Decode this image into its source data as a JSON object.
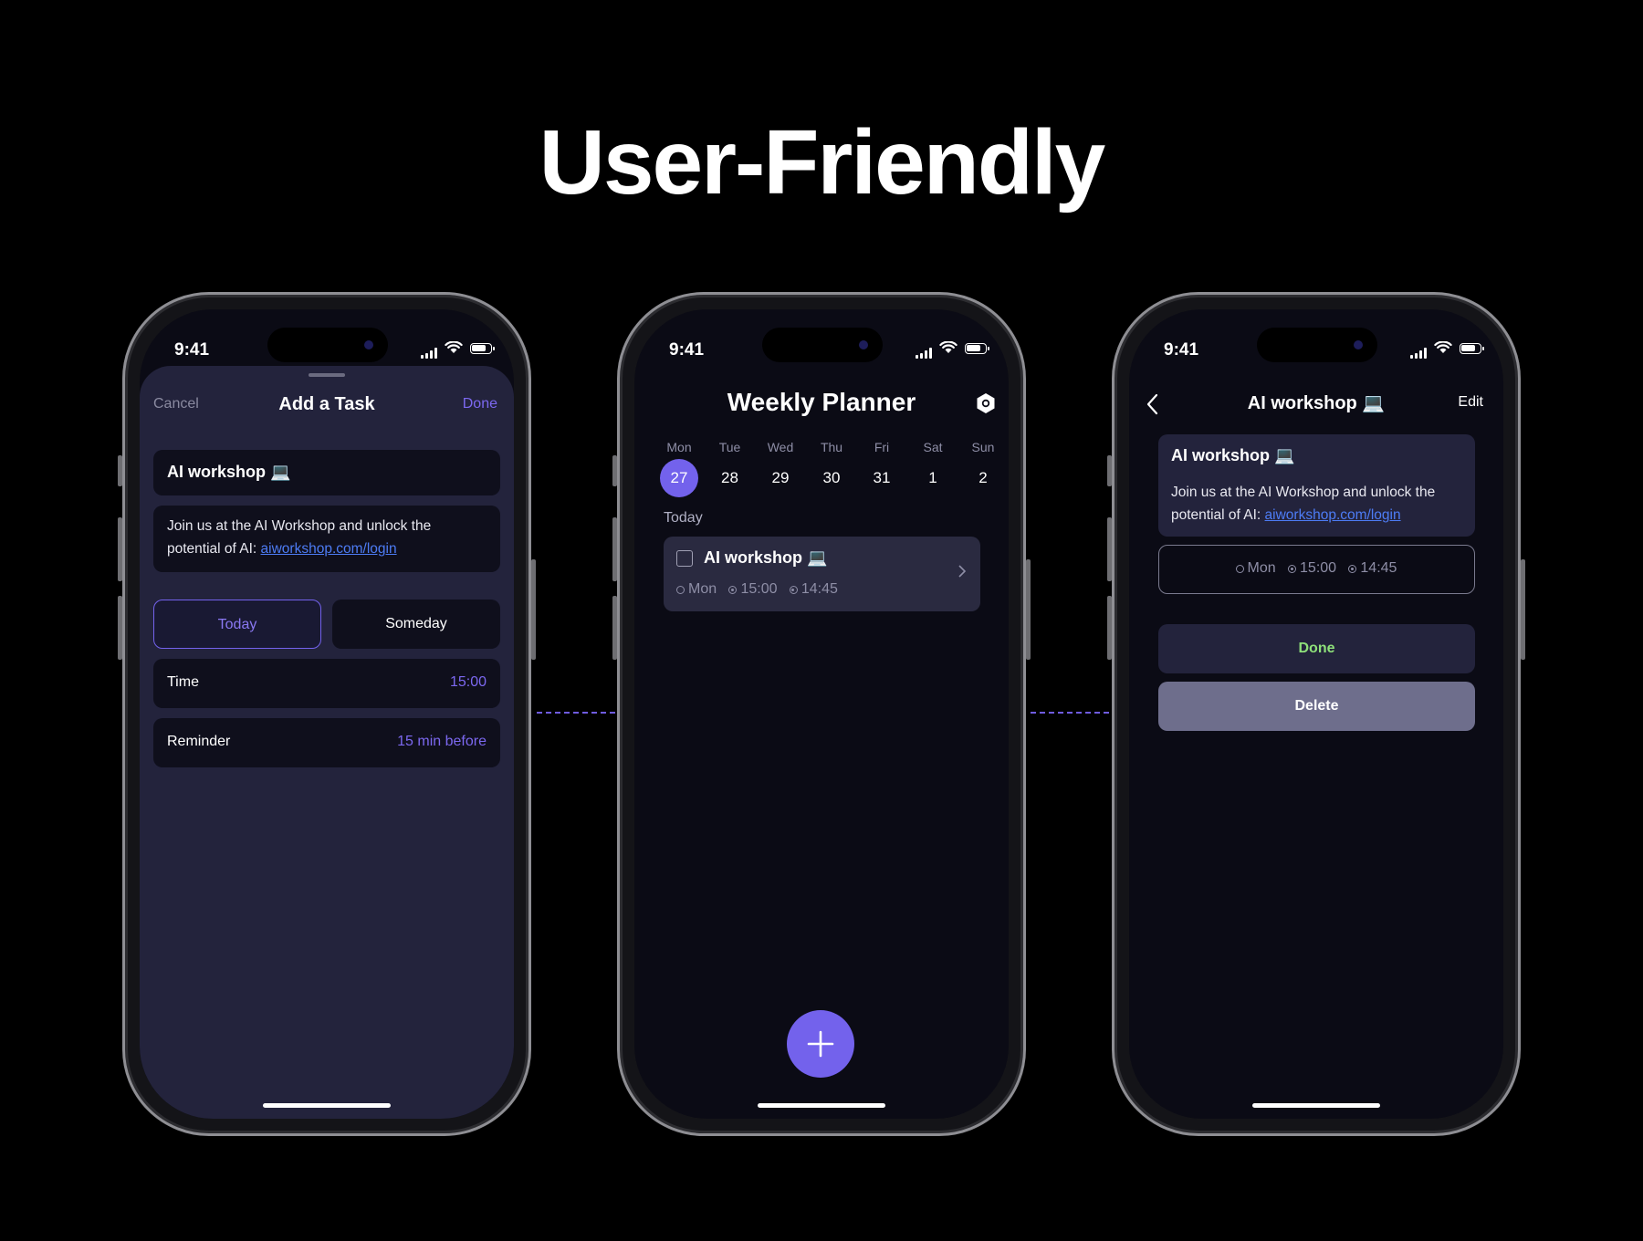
{
  "headline": "User-Friendly",
  "colors": {
    "accent": "#7362ec",
    "link": "#4d7cf5",
    "done_green": "#8ee07a",
    "sheet_bg": "#23233c"
  },
  "status": {
    "time": "9:41"
  },
  "add_task": {
    "cancel_label": "Cancel",
    "title": "Add  a Task",
    "done_label": "Done",
    "task_title": "AI workshop 💻",
    "description_text": "Join us at the AI Workshop and unlock the potential of AI: ",
    "description_link": "aiworkshop.com/login",
    "segment_today": "Today",
    "segment_someday": "Someday",
    "time_label": "Time",
    "time_value": "15:00",
    "reminder_label": "Reminder",
    "reminder_value": "15 min before"
  },
  "planner": {
    "title": "Weekly Planner",
    "days": [
      {
        "dow": "Mon",
        "num": "27",
        "selected": true
      },
      {
        "dow": "Tue",
        "num": "28"
      },
      {
        "dow": "Wed",
        "num": "29"
      },
      {
        "dow": "Thu",
        "num": "30"
      },
      {
        "dow": "Fri",
        "num": "31"
      },
      {
        "dow": "Sat",
        "num": "1"
      },
      {
        "dow": "Sun",
        "num": "2"
      }
    ],
    "section": "Today",
    "task": {
      "title": "AI workshop 💻",
      "day": "Mon",
      "time": "15:00",
      "reminder": "14:45"
    }
  },
  "detail": {
    "title": "AI workshop 💻",
    "edit_label": "Edit",
    "card_title": "AI workshop 💻",
    "description_text": "Join us at the AI Workshop and unlock the potential of AI: ",
    "description_link": "aiworkshop.com/login",
    "day": "Mon",
    "time": "15:00",
    "reminder": "14:45",
    "done_label": "Done",
    "delete_label": "Delete"
  }
}
